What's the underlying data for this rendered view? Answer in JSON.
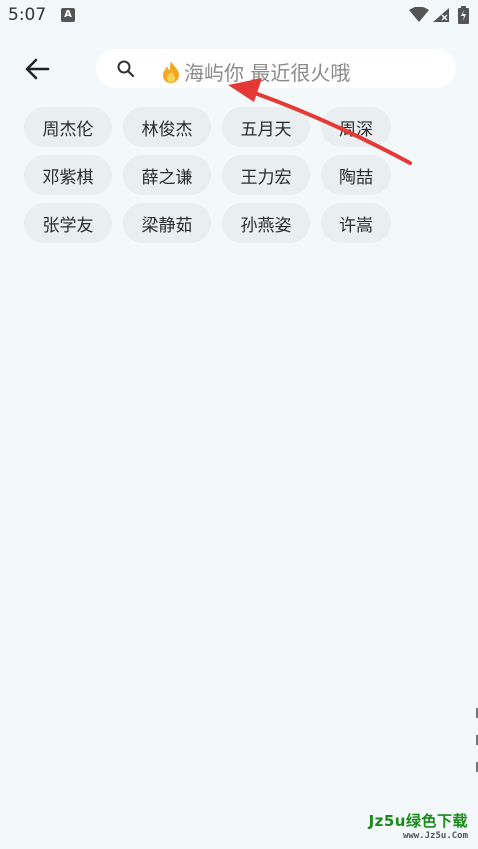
{
  "status_bar": {
    "time": "5:07",
    "notification_icon": "A"
  },
  "search": {
    "placeholder": "海屿你 最近很火哦",
    "hot_icon": "fire-icon"
  },
  "tags": [
    "周杰伦",
    "林俊杰",
    "五月天",
    "周深",
    "邓紫棋",
    "薛之谦",
    "王力宏",
    "陶喆",
    "张学友",
    "梁静茹",
    "孙燕姿",
    "许嵩"
  ],
  "watermark": {
    "main": "Jz5u绿色下载",
    "sub": "www.Jz5u.Com"
  },
  "colors": {
    "background": "#f3f8fa",
    "tag_background": "#e9eef0",
    "annotation_arrow": "#e53935",
    "watermark_green": "#1a8a1a"
  }
}
